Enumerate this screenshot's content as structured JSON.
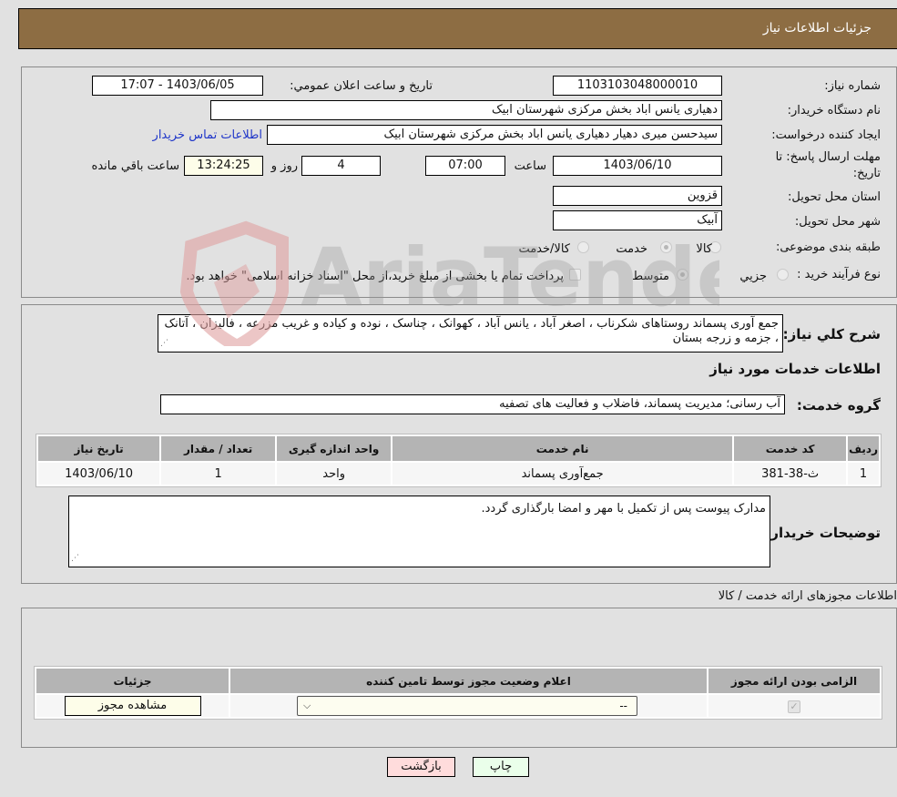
{
  "header": {
    "title": "جزئیات اطلاعات نیاز"
  },
  "form": {
    "need_number": {
      "label": "شماره نیاز:",
      "value": "1103103048000010"
    },
    "announce_datetime": {
      "label": "تاریخ و ساعت اعلان عمومي:",
      "value": "1403/06/05 - 17:07"
    },
    "buyer_org": {
      "label": "نام دستگاه خريدار:",
      "value": "دهیاری یانس اباد بخش مرکزی شهرستان ابیک"
    },
    "requester": {
      "label": "ايجاد کننده درخواست:",
      "value": "سیدحسن میری دهیار دهیاری یانس اباد بخش مرکزی شهرستان ابیک",
      "contact_link": "اطلاعات تماس خريدار"
    },
    "deadline": {
      "label_line1": "مهلت ارسال پاسخ: تا",
      "label_line2": "تاريخ:",
      "date": "1403/06/10",
      "time_label": "ساعت",
      "time": "07:00",
      "days": "4",
      "days_label": "روز و",
      "remaining": "13:24:25",
      "remaining_label": "ساعت باقي مانده"
    },
    "province": {
      "label": "استان محل تحويل:",
      "value": "قزوين"
    },
    "city": {
      "label": "شهر محل تحويل:",
      "value": "آبیک"
    },
    "category": {
      "label": "طبقه بندی موضوعی:",
      "options": [
        "کالا",
        "خدمت",
        "کالا/خدمت"
      ],
      "selected": "خدمت"
    },
    "purchase_type": {
      "label": "نوع فرآيند خريد :",
      "options": [
        "جزيي",
        "متوسط"
      ],
      "selected": "متوسط",
      "treasury_note": "پرداخت تمام يا بخشی از مبلغ خريد،از محل \"اسناد خزانه اسلامی\" خواهد بود."
    }
  },
  "description": {
    "label": "شرح کلي نياز:",
    "value": "جمع آوری پسماند روستاهای شکرناب ، اصغر آباد ، یانس آباد ، کهوانک ، چناسک ، نوده و کیاده و غریب مزرعه ، فالیزان ، آتانک ، جزمه و زرجه بستان"
  },
  "services": {
    "section_title": "اطلاعات خدمات مورد نياز",
    "group_label": "گروه خدمت:",
    "group_value": "آب رسانی؛ مدیریت پسماند، فاضلاب و فعالیت های تصفیه",
    "columns": [
      "رديف",
      "کد خدمت",
      "نام خدمت",
      "واحد اندازه گيری",
      "تعداد / مقدار",
      "تاريخ نياز"
    ],
    "rows": [
      [
        "1",
        "ث-38-381",
        "جمع‌آوری پسماند",
        "واحد",
        "1",
        "1403/06/10"
      ]
    ]
  },
  "buyer_notes": {
    "label": "توضيحات خريدار:",
    "value": "مدارک پیوست پس از تکمیل با مهر و امضا بارگذاری گردد."
  },
  "permits": {
    "section_title": "اطلاعات مجوزهای ارائه خدمت / کالا",
    "columns": [
      "الزامی بودن ارائه مجوز",
      "اعلام وضعيت مجوز توسط تامين کننده",
      "جزئيات"
    ],
    "rows": [
      {
        "required": true,
        "status_selected": "--",
        "details_button": "مشاهده مجوز"
      }
    ]
  },
  "footer": {
    "print_button": "چاپ",
    "back_button": "بازگشت"
  },
  "colors": {
    "header_bg": "#8d6d43",
    "back_btn_bg": "#ffdcdc",
    "print_btn_bg": "#eaffea",
    "link": "#1f36c9"
  }
}
